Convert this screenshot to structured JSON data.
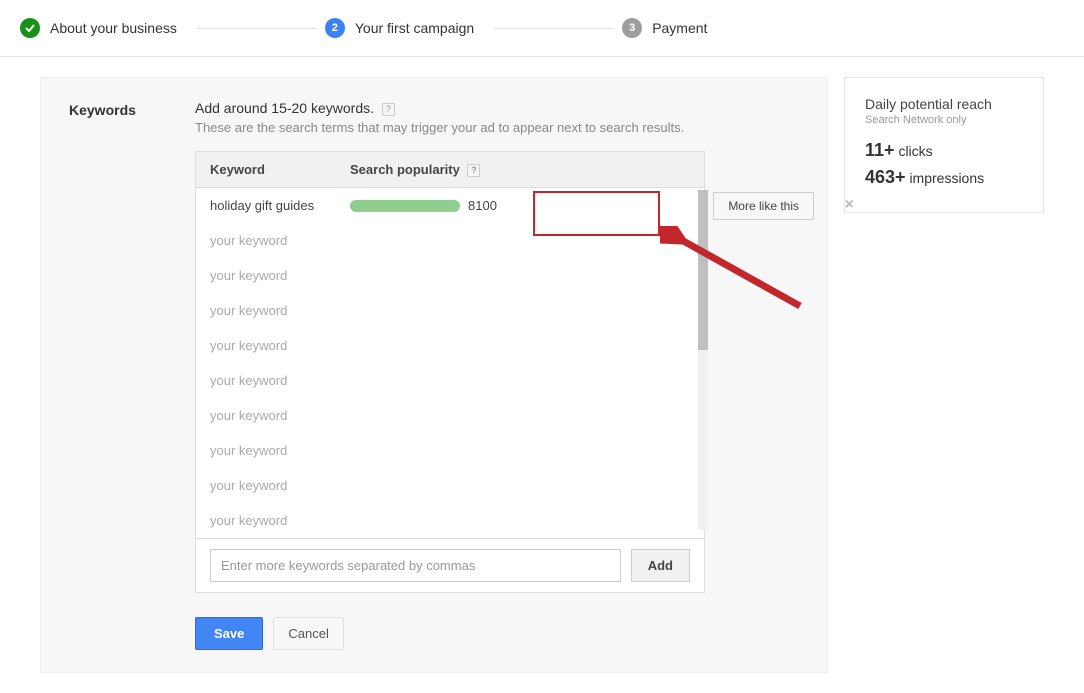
{
  "stepper": {
    "steps": [
      {
        "label": "About your business",
        "state": "done"
      },
      {
        "label": "Your first campaign",
        "state": "active",
        "num": "2"
      },
      {
        "label": "Payment",
        "state": "pending",
        "num": "3"
      }
    ]
  },
  "keywords": {
    "section_label": "Keywords",
    "heading": "Add around 15-20 keywords.",
    "subheading": "These are the search terms that may trigger your ad to appear next to search results.",
    "columns": {
      "keyword": "Keyword",
      "popularity": "Search popularity"
    },
    "rows": [
      {
        "keyword": "holiday gift guides",
        "popularity": 8100,
        "placeholder": false,
        "more_like_this": "More like this"
      },
      {
        "keyword": "your keyword",
        "placeholder": true
      },
      {
        "keyword": "your keyword",
        "placeholder": true
      },
      {
        "keyword": "your keyword",
        "placeholder": true
      },
      {
        "keyword": "your keyword",
        "placeholder": true
      },
      {
        "keyword": "your keyword",
        "placeholder": true
      },
      {
        "keyword": "your keyword",
        "placeholder": true
      },
      {
        "keyword": "your keyword",
        "placeholder": true
      },
      {
        "keyword": "your keyword",
        "placeholder": true
      },
      {
        "keyword": "your keyword",
        "placeholder": true
      }
    ],
    "input_placeholder": "Enter more keywords separated by commas",
    "add_label": "Add",
    "save_label": "Save",
    "cancel_label": "Cancel"
  },
  "reach": {
    "title": "Daily potential reach",
    "sub": "Search Network only",
    "clicks_value": "11+",
    "clicks_label": "clicks",
    "impressions_value": "463+",
    "impressions_label": "impressions"
  }
}
